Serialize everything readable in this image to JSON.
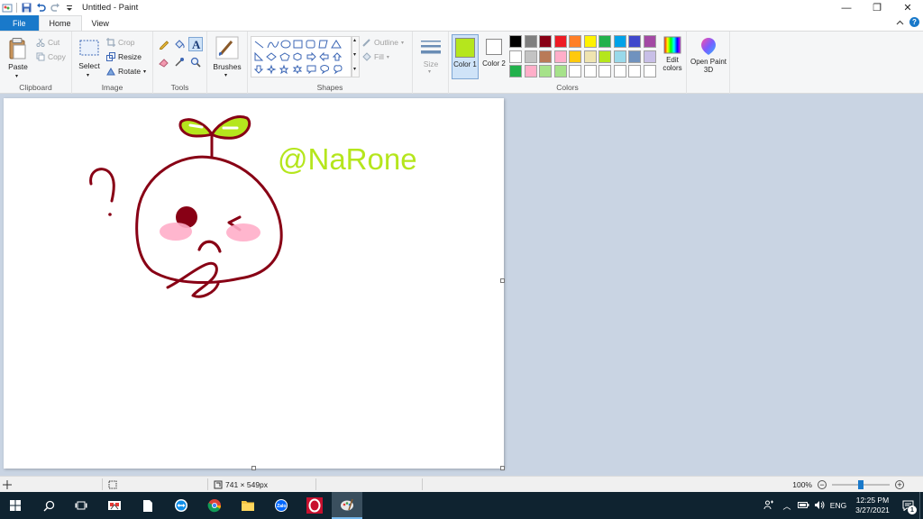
{
  "titlebar": {
    "title": "Untitled - Paint",
    "minimize": "—",
    "maximize": "❐",
    "close": "✕"
  },
  "tabs": [
    {
      "label": "File"
    },
    {
      "label": "Home"
    },
    {
      "label": "View"
    }
  ],
  "ribbon": {
    "clipboard": {
      "group_label": "Clipboard",
      "paste": "Paste",
      "cut": "Cut",
      "copy": "Copy"
    },
    "image": {
      "group_label": "Image",
      "select": "Select",
      "crop": "Crop",
      "resize": "Resize",
      "rotate": "Rotate"
    },
    "tools": {
      "group_label": "Tools"
    },
    "brushes": {
      "label": "Brushes"
    },
    "shapes": {
      "group_label": "Shapes",
      "outline": "Outline",
      "fill": "Fill"
    },
    "size": {
      "label": "Size"
    },
    "colors": {
      "group_label": "Colors",
      "color1_label": "Color 1",
      "color2_label": "Color 2",
      "color1_value": "#b5e61d",
      "color2_value": "#ffffff",
      "edit_colors": "Edit colors",
      "palette_row1": [
        "#000000",
        "#7f7f7f",
        "#880015",
        "#ed1c24",
        "#ff7f27",
        "#fff200",
        "#22b14c",
        "#00a2e8",
        "#3f48cc",
        "#a349a4"
      ],
      "palette_row2": [
        "#ffffff",
        "#c3c3c3",
        "#b97a57",
        "#ffaec9",
        "#ffc90e",
        "#efe4b0",
        "#b5e61d",
        "#99d9ea",
        "#7092be",
        "#c8bfe7"
      ],
      "palette_row3": [
        "#22b14c",
        "#ffaec9",
        "#a6e28a",
        "#a6e28a",
        "#ffffff",
        "#ffffff",
        "#ffffff",
        "#ffffff",
        "#ffffff",
        "#ffffff"
      ]
    },
    "paint3d": {
      "label": "Open Paint 3D"
    }
  },
  "canvas": {
    "watermark": "@NaRone"
  },
  "statusbar": {
    "dimensions": "741 × 549px",
    "zoom": "100%"
  },
  "taskbar": {
    "language": "ENG",
    "time": "12:25 PM",
    "date": "3/27/2021",
    "notification_count": "1"
  }
}
